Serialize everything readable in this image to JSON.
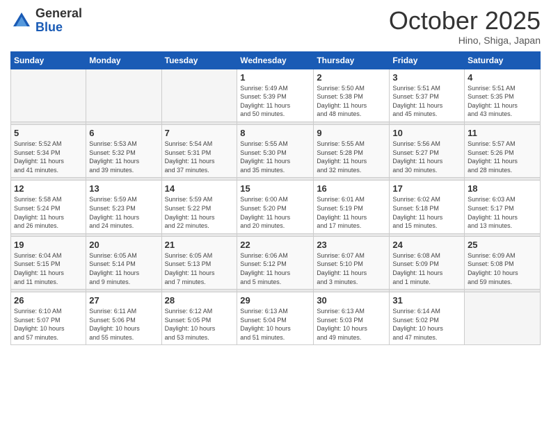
{
  "logo": {
    "general": "General",
    "blue": "Blue"
  },
  "header": {
    "month": "October 2025",
    "location": "Hino, Shiga, Japan"
  },
  "weekdays": [
    "Sunday",
    "Monday",
    "Tuesday",
    "Wednesday",
    "Thursday",
    "Friday",
    "Saturday"
  ],
  "weeks": [
    [
      {
        "day": "",
        "info": ""
      },
      {
        "day": "",
        "info": ""
      },
      {
        "day": "",
        "info": ""
      },
      {
        "day": "1",
        "info": "Sunrise: 5:49 AM\nSunset: 5:39 PM\nDaylight: 11 hours\nand 50 minutes."
      },
      {
        "day": "2",
        "info": "Sunrise: 5:50 AM\nSunset: 5:38 PM\nDaylight: 11 hours\nand 48 minutes."
      },
      {
        "day": "3",
        "info": "Sunrise: 5:51 AM\nSunset: 5:37 PM\nDaylight: 11 hours\nand 45 minutes."
      },
      {
        "day": "4",
        "info": "Sunrise: 5:51 AM\nSunset: 5:35 PM\nDaylight: 11 hours\nand 43 minutes."
      }
    ],
    [
      {
        "day": "5",
        "info": "Sunrise: 5:52 AM\nSunset: 5:34 PM\nDaylight: 11 hours\nand 41 minutes."
      },
      {
        "day": "6",
        "info": "Sunrise: 5:53 AM\nSunset: 5:32 PM\nDaylight: 11 hours\nand 39 minutes."
      },
      {
        "day": "7",
        "info": "Sunrise: 5:54 AM\nSunset: 5:31 PM\nDaylight: 11 hours\nand 37 minutes."
      },
      {
        "day": "8",
        "info": "Sunrise: 5:55 AM\nSunset: 5:30 PM\nDaylight: 11 hours\nand 35 minutes."
      },
      {
        "day": "9",
        "info": "Sunrise: 5:55 AM\nSunset: 5:28 PM\nDaylight: 11 hours\nand 32 minutes."
      },
      {
        "day": "10",
        "info": "Sunrise: 5:56 AM\nSunset: 5:27 PM\nDaylight: 11 hours\nand 30 minutes."
      },
      {
        "day": "11",
        "info": "Sunrise: 5:57 AM\nSunset: 5:26 PM\nDaylight: 11 hours\nand 28 minutes."
      }
    ],
    [
      {
        "day": "12",
        "info": "Sunrise: 5:58 AM\nSunset: 5:24 PM\nDaylight: 11 hours\nand 26 minutes."
      },
      {
        "day": "13",
        "info": "Sunrise: 5:59 AM\nSunset: 5:23 PM\nDaylight: 11 hours\nand 24 minutes."
      },
      {
        "day": "14",
        "info": "Sunrise: 5:59 AM\nSunset: 5:22 PM\nDaylight: 11 hours\nand 22 minutes."
      },
      {
        "day": "15",
        "info": "Sunrise: 6:00 AM\nSunset: 5:20 PM\nDaylight: 11 hours\nand 20 minutes."
      },
      {
        "day": "16",
        "info": "Sunrise: 6:01 AM\nSunset: 5:19 PM\nDaylight: 11 hours\nand 17 minutes."
      },
      {
        "day": "17",
        "info": "Sunrise: 6:02 AM\nSunset: 5:18 PM\nDaylight: 11 hours\nand 15 minutes."
      },
      {
        "day": "18",
        "info": "Sunrise: 6:03 AM\nSunset: 5:17 PM\nDaylight: 11 hours\nand 13 minutes."
      }
    ],
    [
      {
        "day": "19",
        "info": "Sunrise: 6:04 AM\nSunset: 5:15 PM\nDaylight: 11 hours\nand 11 minutes."
      },
      {
        "day": "20",
        "info": "Sunrise: 6:05 AM\nSunset: 5:14 PM\nDaylight: 11 hours\nand 9 minutes."
      },
      {
        "day": "21",
        "info": "Sunrise: 6:05 AM\nSunset: 5:13 PM\nDaylight: 11 hours\nand 7 minutes."
      },
      {
        "day": "22",
        "info": "Sunrise: 6:06 AM\nSunset: 5:12 PM\nDaylight: 11 hours\nand 5 minutes."
      },
      {
        "day": "23",
        "info": "Sunrise: 6:07 AM\nSunset: 5:10 PM\nDaylight: 11 hours\nand 3 minutes."
      },
      {
        "day": "24",
        "info": "Sunrise: 6:08 AM\nSunset: 5:09 PM\nDaylight: 11 hours\nand 1 minute."
      },
      {
        "day": "25",
        "info": "Sunrise: 6:09 AM\nSunset: 5:08 PM\nDaylight: 10 hours\nand 59 minutes."
      }
    ],
    [
      {
        "day": "26",
        "info": "Sunrise: 6:10 AM\nSunset: 5:07 PM\nDaylight: 10 hours\nand 57 minutes."
      },
      {
        "day": "27",
        "info": "Sunrise: 6:11 AM\nSunset: 5:06 PM\nDaylight: 10 hours\nand 55 minutes."
      },
      {
        "day": "28",
        "info": "Sunrise: 6:12 AM\nSunset: 5:05 PM\nDaylight: 10 hours\nand 53 minutes."
      },
      {
        "day": "29",
        "info": "Sunrise: 6:13 AM\nSunset: 5:04 PM\nDaylight: 10 hours\nand 51 minutes."
      },
      {
        "day": "30",
        "info": "Sunrise: 6:13 AM\nSunset: 5:03 PM\nDaylight: 10 hours\nand 49 minutes."
      },
      {
        "day": "31",
        "info": "Sunrise: 6:14 AM\nSunset: 5:02 PM\nDaylight: 10 hours\nand 47 minutes."
      },
      {
        "day": "",
        "info": ""
      }
    ]
  ]
}
